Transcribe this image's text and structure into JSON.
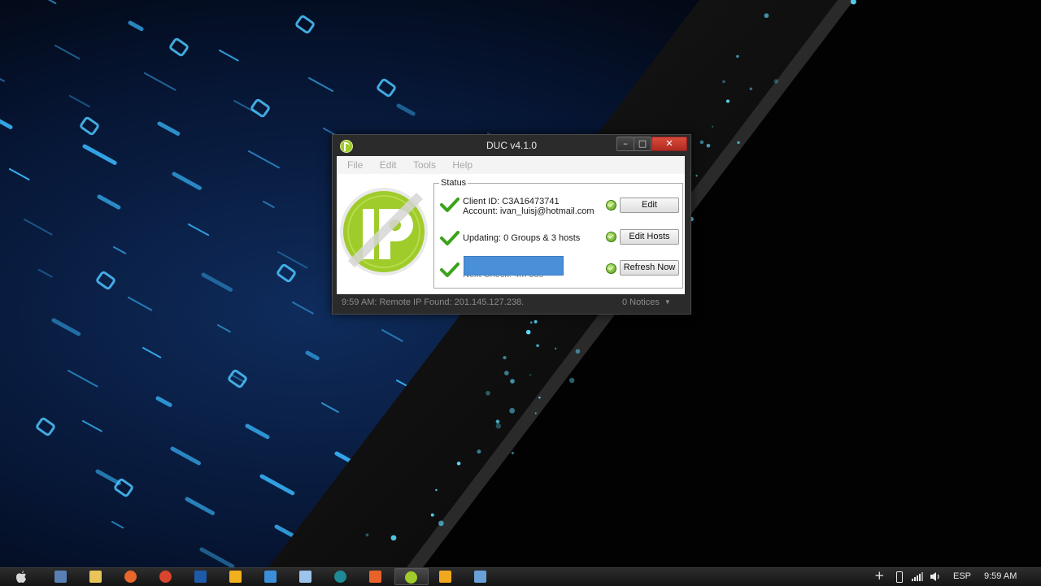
{
  "window": {
    "title": "DUC v4.1.0",
    "controls": {
      "minimize": "–",
      "maximize": "□",
      "close": "✕"
    },
    "menu": [
      "File",
      "Edit",
      "Tools",
      "Help"
    ],
    "status_group_label": "Status",
    "rows": [
      {
        "line1": "Client ID: C3A16473741",
        "line2": "Account: ivan_luisj@hotmail.com",
        "button": "Edit"
      },
      {
        "line1": "Updating: 0 Groups & 3 hosts",
        "button": "Edit Hosts"
      },
      {
        "line1": "Next Check: 4m 38s",
        "button": "Refresh Now"
      }
    ],
    "statusbar": {
      "message": "9:59 AM: Remote IP Found: 201.145.127.238.",
      "notices": "0 Notices"
    }
  },
  "taskbar": {
    "apps": [
      {
        "icon": "window-manager-icon",
        "color": "#5a7fb5"
      },
      {
        "icon": "file-explorer-icon",
        "color": "#e8c45a"
      },
      {
        "icon": "firefox-icon",
        "color": "#e8672a"
      },
      {
        "icon": "chrome-icon",
        "color": "#d9452f"
      },
      {
        "icon": "photoshop-icon",
        "color": "#1d5aa8"
      },
      {
        "icon": "fl-studio-icon",
        "color": "#f2b01e"
      },
      {
        "icon": "app-window-icon",
        "color": "#3b8fd9"
      },
      {
        "icon": "virtualbox-icon",
        "color": "#9cc4ec"
      },
      {
        "icon": "arduino-icon",
        "color": "#1d8a96"
      },
      {
        "icon": "xampp-icon",
        "color": "#e8632a"
      },
      {
        "icon": "duc-icon",
        "color": "#9fcb2b"
      },
      {
        "icon": "media-player-icon",
        "color": "#f2a81e"
      },
      {
        "icon": "remote-desktop-icon",
        "color": "#6aa0d8"
      }
    ],
    "active_index": 10,
    "tray": {
      "show_hidden": "+",
      "language": "ESP",
      "clock": "9:59 AM"
    }
  },
  "colors": {
    "accent_green": "#9fcb2b",
    "close_red": "#c8372a",
    "redaction_blue": "#4a90d9"
  }
}
